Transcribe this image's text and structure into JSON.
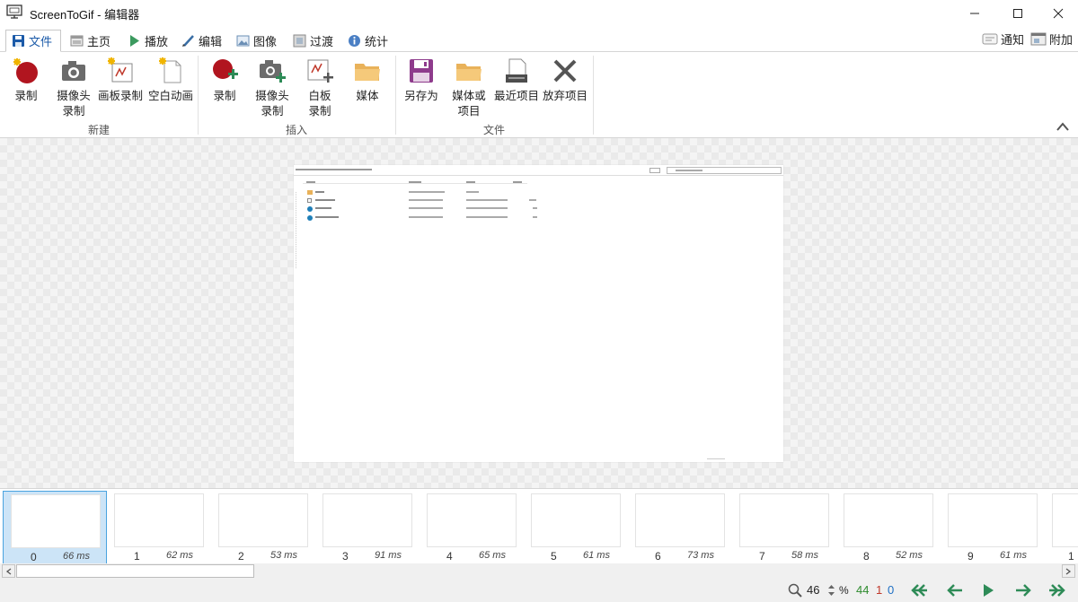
{
  "window": {
    "title": "ScreenToGif - 编辑器"
  },
  "tabs": [
    {
      "label": "文件",
      "icon": "save-icon"
    },
    {
      "label": "主页",
      "icon": "home-icon"
    },
    {
      "label": "播放",
      "icon": "play-icon"
    },
    {
      "label": "编辑",
      "icon": "pencil-icon"
    },
    {
      "label": "图像",
      "icon": "image-icon"
    },
    {
      "label": "过渡",
      "icon": "transition-icon"
    },
    {
      "label": "统计",
      "icon": "info-icon"
    }
  ],
  "right_tabs": [
    {
      "label": "通知",
      "icon": "notification-icon"
    },
    {
      "label": "附加",
      "icon": "extras-icon"
    }
  ],
  "ribbon": {
    "groups": [
      {
        "label": "新建",
        "buttons": [
          {
            "line1": "录制",
            "line2": "",
            "icon": "record-icon"
          },
          {
            "line1": "摄像头",
            "line2": "录制",
            "icon": "webcam-icon"
          },
          {
            "line1": "画板录制",
            "line2": "",
            "icon": "board-record-icon"
          },
          {
            "line1": "空白动画",
            "line2": "",
            "icon": "blank-animation-icon"
          }
        ]
      },
      {
        "label": "插入",
        "buttons": [
          {
            "line1": "录制",
            "line2": "",
            "icon": "insert-record-icon"
          },
          {
            "line1": "摄像头",
            "line2": "录制",
            "icon": "insert-webcam-icon"
          },
          {
            "line1": "白板",
            "line2": "录制",
            "icon": "insert-board-icon"
          },
          {
            "line1": "媒体",
            "line2": "",
            "icon": "insert-media-icon"
          }
        ]
      },
      {
        "label": "文件",
        "buttons": [
          {
            "line1": "另存为",
            "line2": "",
            "icon": "save-as-icon"
          },
          {
            "line1": "媒体或",
            "line2": "项目",
            "icon": "open-media-icon"
          },
          {
            "line1": "最近项目",
            "line2": "",
            "icon": "recent-projects-icon"
          },
          {
            "line1": "放弃项目",
            "line2": "",
            "icon": "discard-icon"
          }
        ]
      }
    ]
  },
  "frames": [
    {
      "index": "0",
      "delay": "66 ms"
    },
    {
      "index": "1",
      "delay": "62 ms"
    },
    {
      "index": "2",
      "delay": "53 ms"
    },
    {
      "index": "3",
      "delay": "91 ms"
    },
    {
      "index": "4",
      "delay": "65 ms"
    },
    {
      "index": "5",
      "delay": "61 ms"
    },
    {
      "index": "6",
      "delay": "73 ms"
    },
    {
      "index": "7",
      "delay": "58 ms"
    },
    {
      "index": "8",
      "delay": "52 ms"
    },
    {
      "index": "9",
      "delay": "61 ms"
    },
    {
      "index": "1",
      "delay": ""
    }
  ],
  "selected_frame": 0,
  "status": {
    "zoom": "46",
    "zoom_unit": "%",
    "total_frames": "44",
    "selected_count": "1",
    "current_frame": "0"
  },
  "colors": {
    "accent": "#1b5aa8",
    "total_frames": "#2e8b2e",
    "selected_count": "#c0392b",
    "current_frame": "#1e6fc4",
    "nav_arrows": "#2e8b57"
  }
}
